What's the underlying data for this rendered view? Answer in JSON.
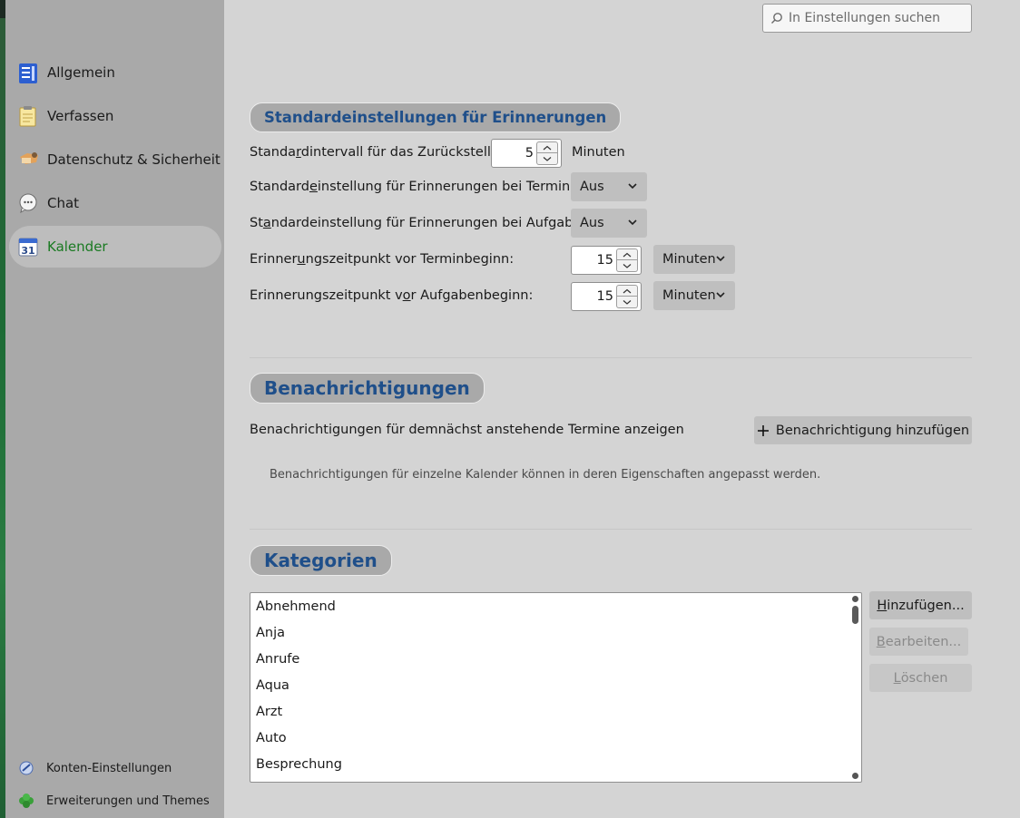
{
  "sidebar": {
    "items": [
      {
        "label": "Allgemein",
        "icon": "general-icon"
      },
      {
        "label": "Verfassen",
        "icon": "compose-icon"
      },
      {
        "label": "Datenschutz & Sicherheit",
        "icon": "privacy-icon"
      },
      {
        "label": "Chat",
        "icon": "chat-icon"
      },
      {
        "label": "Kalender",
        "icon": "calendar-icon",
        "active": true
      }
    ],
    "footer": {
      "accounts_label": "Konten-Einstellungen",
      "addons_label": "Erweiterungen und Themes"
    }
  },
  "search": {
    "placeholder": "In Einstellungen suchen"
  },
  "reminders": {
    "title": "Standardeinstellungen für Erinnerungen",
    "snooze": {
      "label_pre": "Standa",
      "label_u": "r",
      "label_post": "dintervall für das Zurückstellen:",
      "value": "5",
      "unit": "Minuten"
    },
    "events": {
      "label_pre": "Standard",
      "label_u": "e",
      "label_post": "instellung für Erinnerungen bei Terminen:",
      "value": "Aus"
    },
    "tasks": {
      "label_pre": "St",
      "label_u": "a",
      "label_post": "ndardeinstellung für Erinnerungen bei Aufgaben:",
      "value": "Aus"
    },
    "event_offset": {
      "label_pre": "Erinner",
      "label_u": "u",
      "label_post": "ngszeitpunkt vor Terminbeginn:",
      "value": "15",
      "unit": "Minuten"
    },
    "task_offset": {
      "label_pre": "Erinnerungszeitpunkt v",
      "label_u": "o",
      "label_post": "r Aufgabenbeginn:",
      "value": "15",
      "unit": "Minuten"
    }
  },
  "notifications": {
    "title": "Benachrichtigungen",
    "description": "Benachrichtigungen für demnächst anstehende Termine anzeigen",
    "add_button": "Benachrichtigung hinzufügen",
    "hint": "Benachrichtigungen für einzelne Kalender können in deren Eigenschaften angepasst werden."
  },
  "categories": {
    "title": "Kategorien",
    "items": [
      "Abnehmend",
      "Anja",
      "Anrufe",
      "Aqua",
      "Arzt",
      "Auto",
      "Besprechung"
    ],
    "add_u": "H",
    "add_rest": "inzufügen...",
    "edit_u": "B",
    "edit_rest": "earbeiten...",
    "delete_u": "L",
    "delete_rest": "öschen"
  },
  "colors": {
    "accent_green": "#1a7a22",
    "heading_blue": "#1f4f8a"
  }
}
